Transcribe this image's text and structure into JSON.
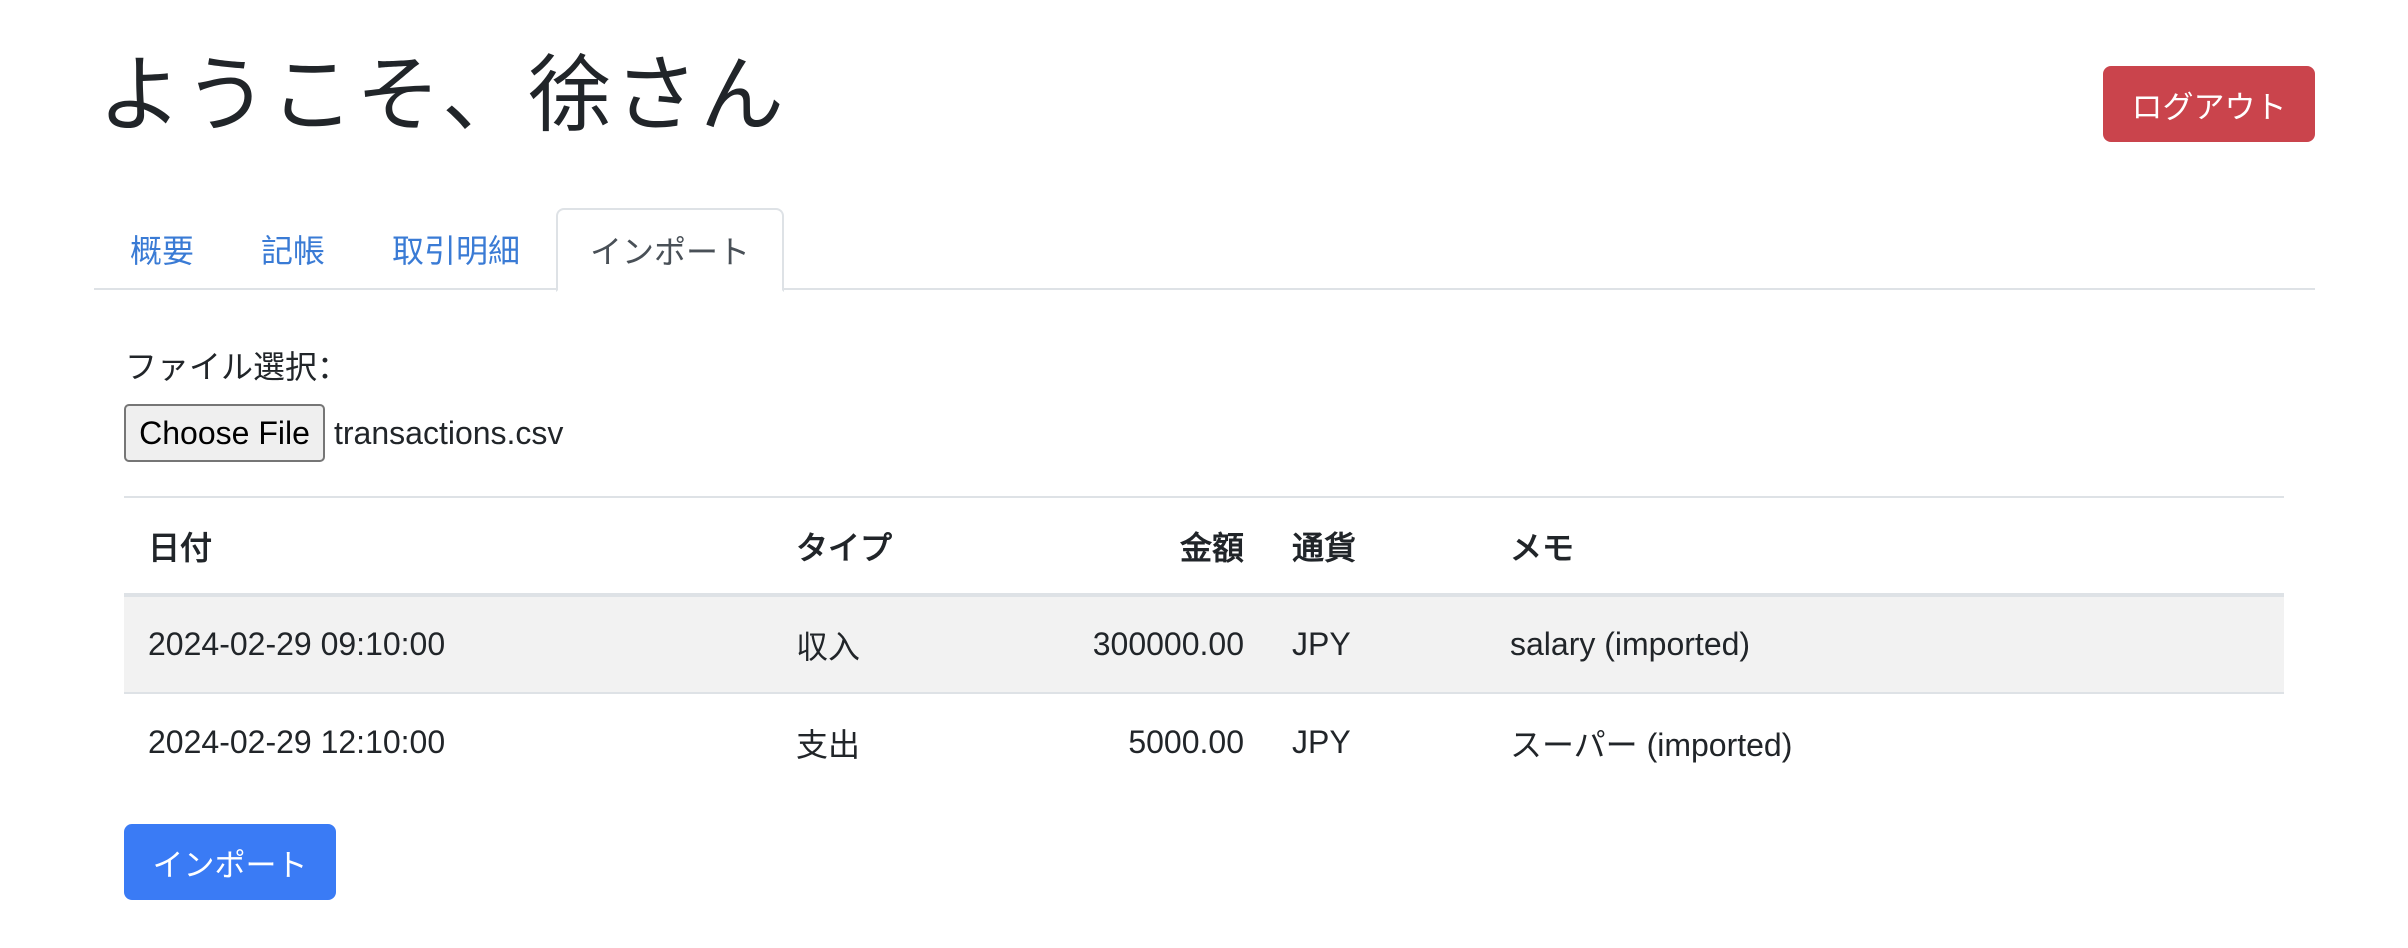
{
  "header": {
    "title": "ようこそ、徐さん",
    "logout_label": "ログアウト"
  },
  "tabs": [
    {
      "label": "概要",
      "active": false
    },
    {
      "label": "記帳",
      "active": false
    },
    {
      "label": "取引明細",
      "active": false
    },
    {
      "label": "インポート",
      "active": true
    }
  ],
  "import_form": {
    "file_label": "ファイル選択：",
    "choose_file_label": "Choose File",
    "file_name": "transactions.csv",
    "submit_label": "インポート"
  },
  "table": {
    "columns": [
      "日付",
      "タイプ",
      "金額",
      "通貨",
      "メモ"
    ],
    "rows": [
      [
        "2024-02-29 09:10:00",
        "収入",
        "300000.00",
        "JPY",
        "salary (imported)"
      ],
      [
        "2024-02-29 12:10:00",
        "支出",
        "5000.00",
        "JPY",
        "スーパー (imported)"
      ]
    ]
  },
  "colors": {
    "primary": "#3a7bf5",
    "danger": "#ca444c",
    "link": "#3a7bd5"
  }
}
